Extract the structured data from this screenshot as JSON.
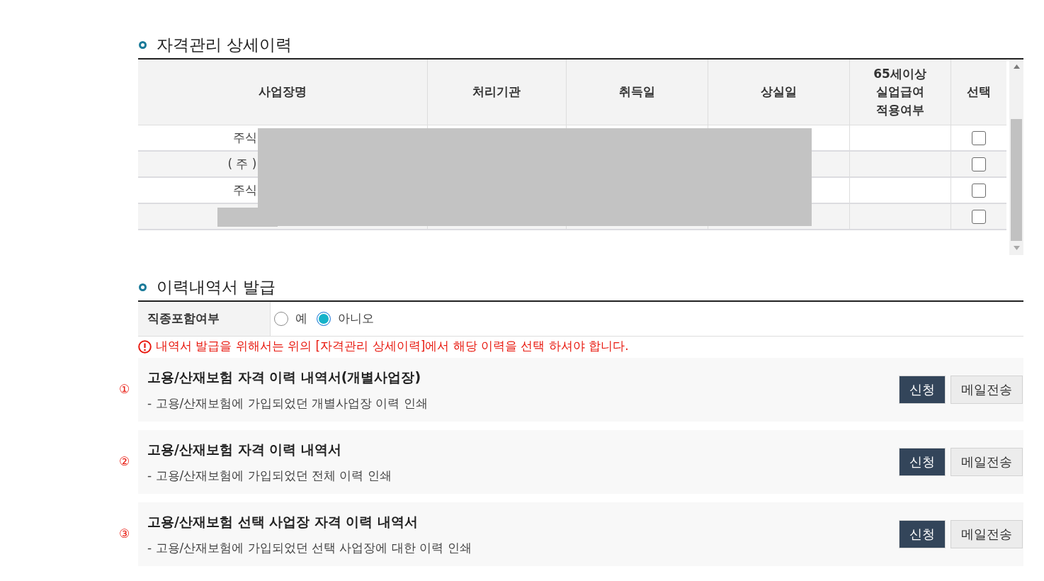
{
  "history_section": {
    "title": "자격관리 상세이력",
    "table": {
      "columns": [
        "사업장명",
        "처리기관",
        "취득일",
        "상실일",
        "65세이상 실업급여 적용여부",
        "선택"
      ],
      "rows": [
        {
          "business_name": "주식",
          "checked": false
        },
        {
          "business_name": "( 주 )",
          "checked": false
        },
        {
          "business_name": "주식",
          "checked": false
        },
        {
          "checked": false
        }
      ]
    }
  },
  "issue_section": {
    "title": "이력내역서 발급",
    "option_label": "직종포함여부",
    "options": [
      {
        "label": "예",
        "selected": false
      },
      {
        "label": "아니오",
        "selected": true
      }
    ],
    "warning": "내역서 발급을 위해서는 위의 [자격관리 상세이력]에서 해당 이력을 선택 하셔야 합니다.",
    "documents": [
      {
        "number": "①",
        "title": "고용/산재보험 자격 이력 내역서(개별사업장)",
        "description": "- 고용/산재보험에 가입되었던 개별사업장 이력 인쇄",
        "buttons": [
          {
            "label": "신청",
            "kind": "primary"
          },
          {
            "label": "메일전송",
            "kind": "secondary"
          }
        ]
      },
      {
        "number": "②",
        "title": "고용/산재보험 자격 이력 내역서",
        "description": "- 고용/산재보험에 가입되었던 전체 이력 인쇄",
        "buttons": [
          {
            "label": "신청",
            "kind": "primary"
          },
          {
            "label": "메일전송",
            "kind": "secondary"
          }
        ]
      },
      {
        "number": "③",
        "title": "고용/산재보험 선택 사업장 자격 이력 내역서",
        "description": "- 고용/산재보험에 가입되었던 선택 사업장에 대한 이력 인쇄",
        "buttons": [
          {
            "label": "신청",
            "kind": "primary"
          },
          {
            "label": "메일전송",
            "kind": "secondary"
          }
        ]
      }
    ]
  }
}
